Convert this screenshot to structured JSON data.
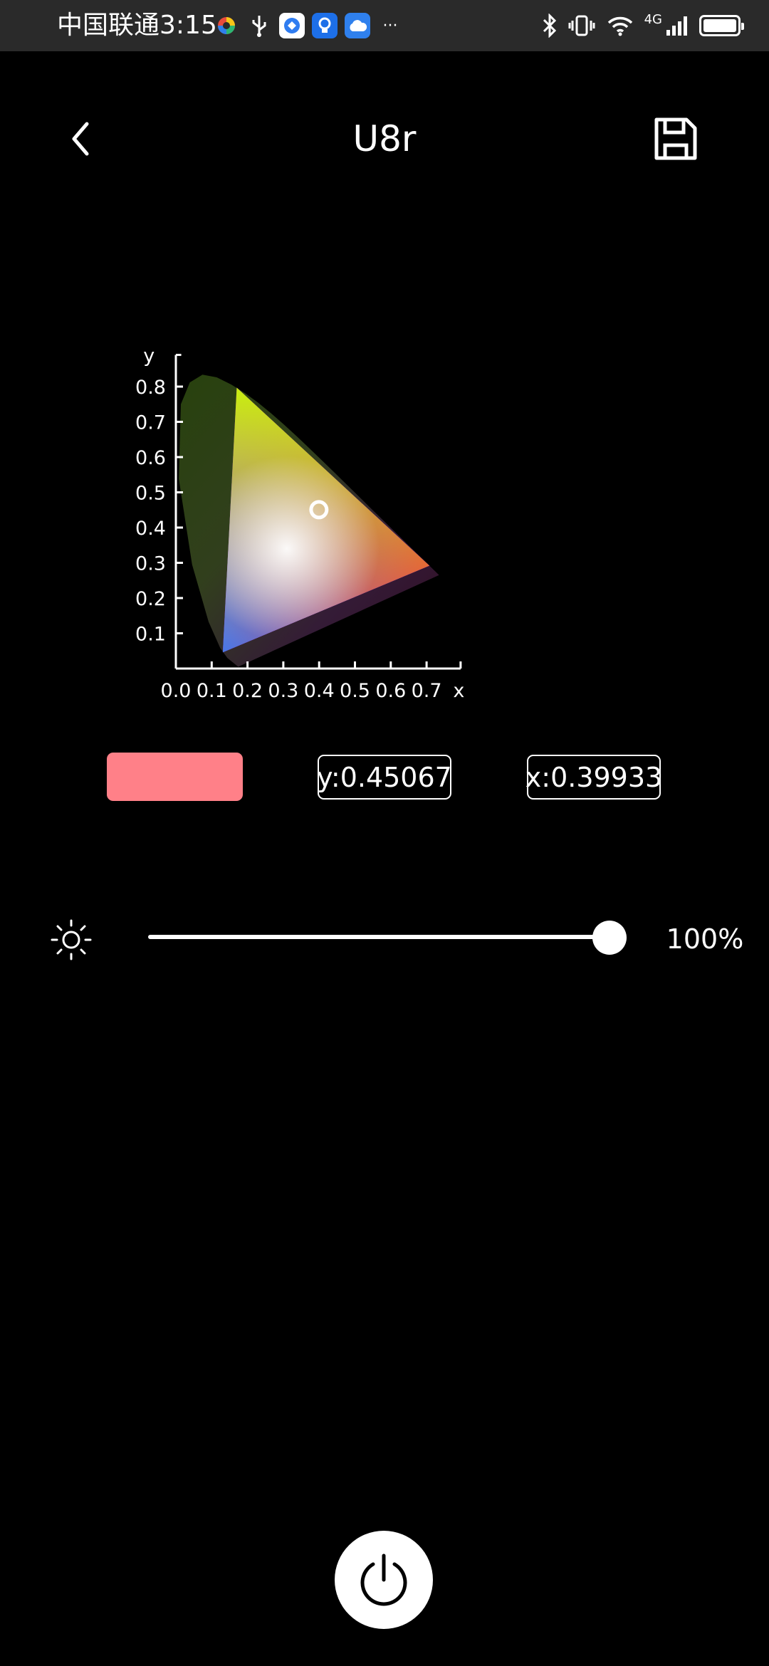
{
  "status_bar": {
    "carrier": "中国联通",
    "time": "3:15",
    "left_icons": [
      "app-pinwheel-icon",
      "usb-icon",
      "app-blue-icon",
      "app-bulb-icon",
      "cloud-icon",
      "more-dots-icon"
    ],
    "right_icons": [
      "bluetooth-icon",
      "vibrate-icon",
      "wifi-icon",
      "signal-icon",
      "battery-icon"
    ],
    "network": "4G",
    "more": "···"
  },
  "header": {
    "title": "U8r",
    "back_icon": "chevron-left-icon",
    "save_icon": "floppy-disk-icon"
  },
  "chart_data": {
    "type": "scatter",
    "title": "",
    "xlabel": "x",
    "ylabel": "y",
    "xlim": [
      0.0,
      0.8
    ],
    "ylim": [
      0.0,
      0.9
    ],
    "x_ticks": [
      "0.0",
      "0.1",
      "0.2",
      "0.3",
      "0.4",
      "0.5",
      "0.6",
      "0.7"
    ],
    "y_ticks": [
      "0.1",
      "0.2",
      "0.3",
      "0.4",
      "0.5",
      "0.6",
      "0.7",
      "0.8"
    ],
    "gamut_triangle": [
      [
        0.708,
        0.292
      ],
      [
        0.17,
        0.797
      ],
      [
        0.131,
        0.046
      ]
    ],
    "selected_point": {
      "x": 0.39933,
      "y": 0.45067
    }
  },
  "color": {
    "swatch": "#ff8088",
    "y_label": "y:0.45067",
    "x_label": "x:0.39933"
  },
  "brightness": {
    "icon": "sun-icon",
    "level": 1.0,
    "value_label": "100%"
  },
  "power": {
    "icon": "power-icon"
  }
}
